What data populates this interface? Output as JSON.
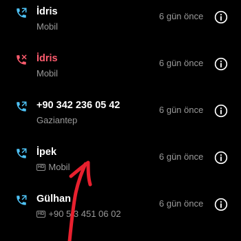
{
  "colors": {
    "background": "#000000",
    "primary_text": "#ffffff",
    "secondary_text": "#9a9a9a",
    "missed_call": "#ff5c6e",
    "outgoing_call": "#4fc3f7",
    "gesture_stroke": "#e8202e"
  },
  "calls": [
    {
      "name": "İdris",
      "subtitle": "Mobil",
      "time": "6 gün önce",
      "call_type": "outgoing",
      "icon": "outgoing-call-icon",
      "hd": false
    },
    {
      "name": "İdris",
      "subtitle": "Mobil",
      "time": "6 gün önce",
      "call_type": "missed",
      "icon": "missed-call-icon",
      "hd": false
    },
    {
      "name": "+90 342 236 05 42",
      "subtitle": "Gaziantep",
      "time": "6 gün önce",
      "call_type": "outgoing",
      "icon": "outgoing-call-icon",
      "hd": false
    },
    {
      "name": "İpek",
      "subtitle": "Mobil",
      "time": "6 gün önce",
      "call_type": "outgoing",
      "icon": "outgoing-call-icon",
      "hd": true,
      "hd_label": "HD"
    },
    {
      "name": "Gülhan",
      "subtitle": "+90 5 3 451 06 02",
      "time": "6 gün önce",
      "call_type": "outgoing",
      "icon": "outgoing-call-icon",
      "hd": true,
      "hd_label": "HD"
    }
  ],
  "info_icon": "info-icon",
  "gesture": {
    "icon": "swipe-up-arrow-icon",
    "direction": "up"
  }
}
